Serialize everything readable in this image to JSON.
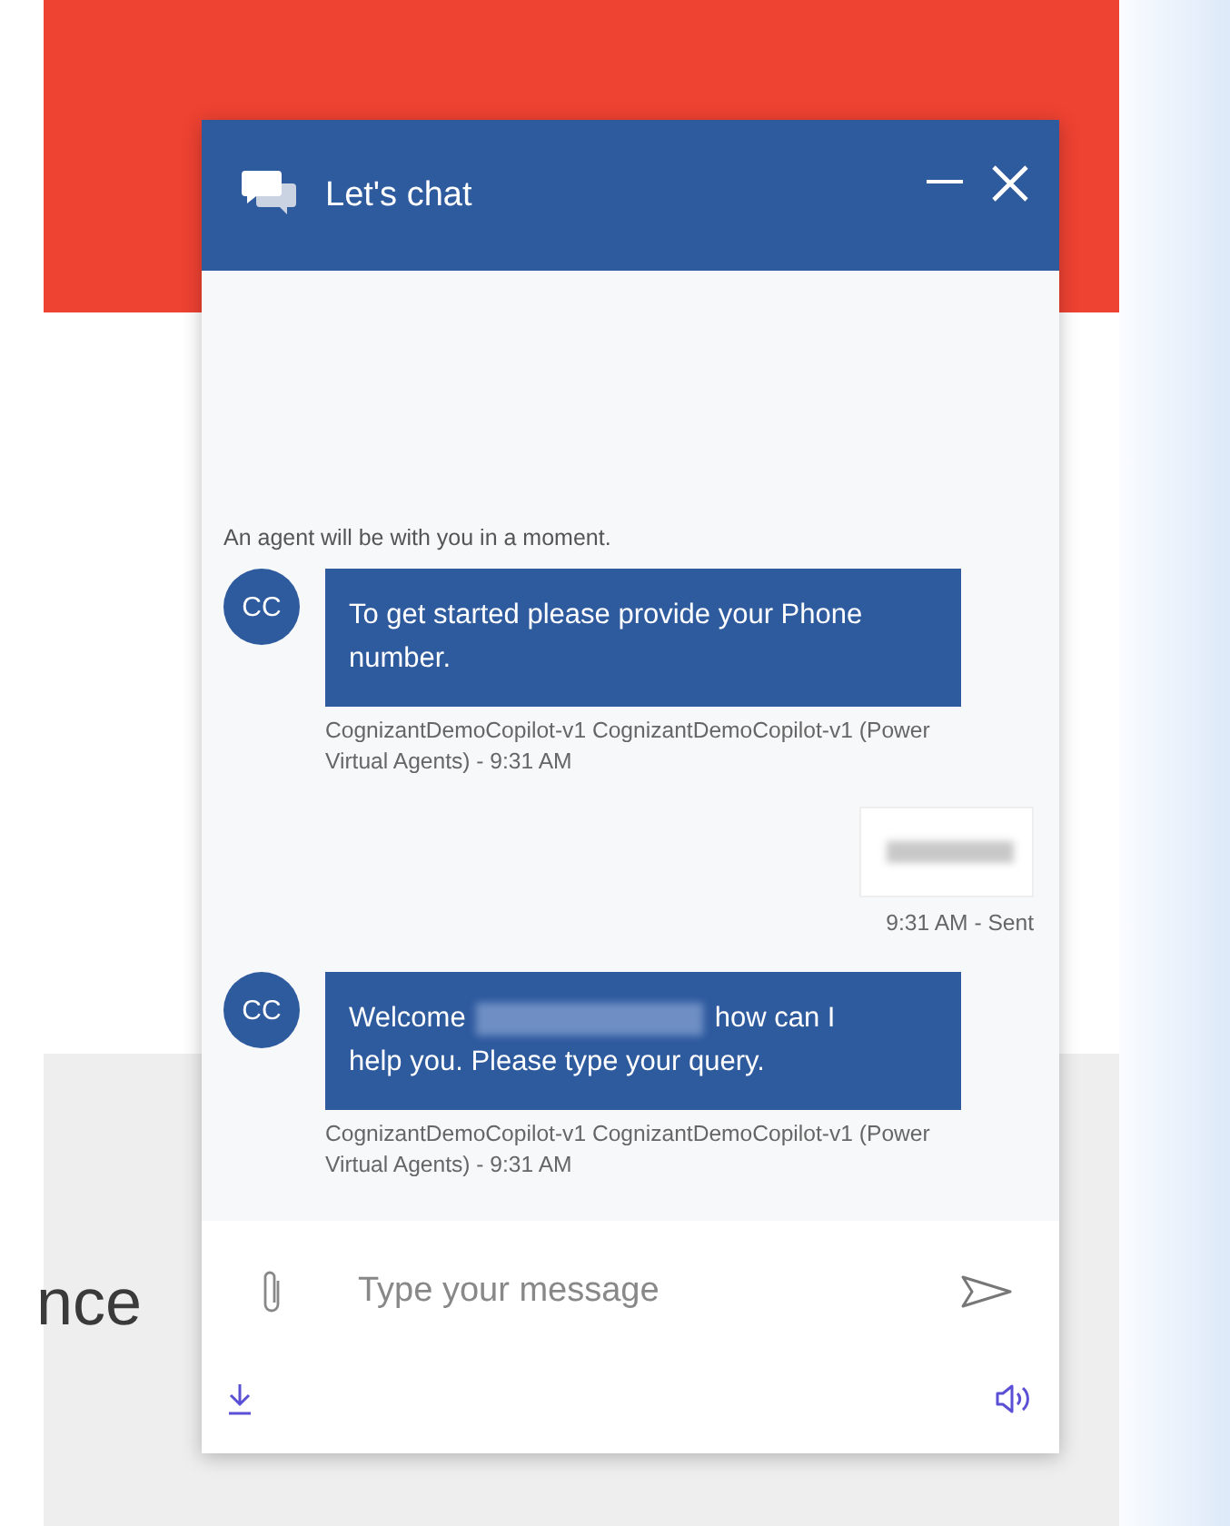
{
  "background": {
    "partial_heading": "nce"
  },
  "chat": {
    "title": "Let's chat",
    "status": "An agent will be with you in a moment.",
    "messages": [
      {
        "kind": "bot",
        "avatar": "CC",
        "segments": [
          {
            "kind": "text",
            "text": "To get started please provide your Phone number."
          }
        ],
        "meta": "CognizantDemoCopilot-v1 CognizantDemoCopilot-v1 (Power Virtual Agents) - 9:31 AM"
      },
      {
        "kind": "user",
        "segments": [
          {
            "kind": "redacted"
          }
        ],
        "meta": "9:31 AM - Sent"
      },
      {
        "kind": "bot",
        "avatar": "CC",
        "segments": [
          {
            "kind": "text",
            "text": "Welcome"
          },
          {
            "kind": "redacted"
          },
          {
            "kind": "text",
            "text": "how can I"
          },
          {
            "kind": "text",
            "text": "help you. Please type your query."
          }
        ],
        "meta": "CognizantDemoCopilot-v1 CognizantDemoCopilot-v1 (Power Virtual Agents) - 9:31 AM"
      }
    ],
    "input": {
      "placeholder": "Type your message"
    }
  }
}
